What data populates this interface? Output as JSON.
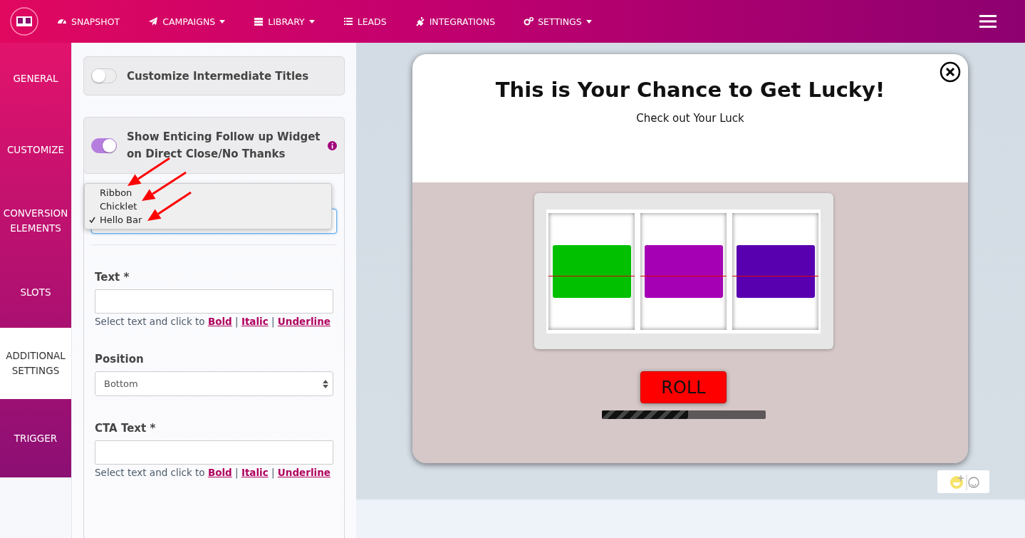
{
  "nav": {
    "items": [
      {
        "label": "SNAPSHOT",
        "dropdown": false
      },
      {
        "label": "CAMPAIGNS",
        "dropdown": true
      },
      {
        "label": "LIBRARY",
        "dropdown": true
      },
      {
        "label": "LEADS",
        "dropdown": false
      },
      {
        "label": "INTEGRATIONS",
        "dropdown": false
      },
      {
        "label": "SETTINGS",
        "dropdown": true
      }
    ]
  },
  "sidebar": {
    "items": [
      {
        "label": "GENERAL",
        "selected": false
      },
      {
        "label": "CUSTOMIZE",
        "selected": false
      },
      {
        "label": "CONVERSION ELEMENTS",
        "selected": false
      },
      {
        "label": "SLOTS",
        "selected": false
      },
      {
        "label": "ADDITIONAL SETTINGS",
        "selected": true
      },
      {
        "label": "TRIGGER",
        "selected": false
      }
    ]
  },
  "settings": {
    "toggles": [
      {
        "label": "Customize Intermediate Titles",
        "on": false,
        "info": false
      },
      {
        "label": "Show Enticing Follow up Widget on Direct Close/No Thanks",
        "on": true,
        "info": true
      }
    ],
    "widget_type": {
      "options": [
        {
          "label": "Ribbon",
          "selected": false
        },
        {
          "label": "Chicklet",
          "selected": false
        },
        {
          "label": "Hello Bar",
          "selected": true
        }
      ]
    },
    "fields": [
      {
        "kind": "text",
        "label": "Text *",
        "help": "Select text and click to",
        "links": [
          "Bold",
          "Italic",
          "Underline"
        ],
        "separator": "|"
      },
      {
        "kind": "select",
        "label": "Position",
        "value": "Bottom"
      },
      {
        "kind": "text",
        "label": "CTA Text *",
        "help": "Select text and click to",
        "links": [
          "Bold",
          "Italic",
          "Underline"
        ],
        "separator": "|"
      }
    ]
  },
  "preview": {
    "title": "This is Your Chance to Get Lucky!",
    "subtitle": "Check out Your Luck",
    "reels": [
      {
        "color": "#00c000"
      },
      {
        "color": "#a600b5"
      },
      {
        "color": "#5800b0"
      }
    ],
    "button": "ROLL",
    "progress": {
      "level": 0.53
    }
  }
}
